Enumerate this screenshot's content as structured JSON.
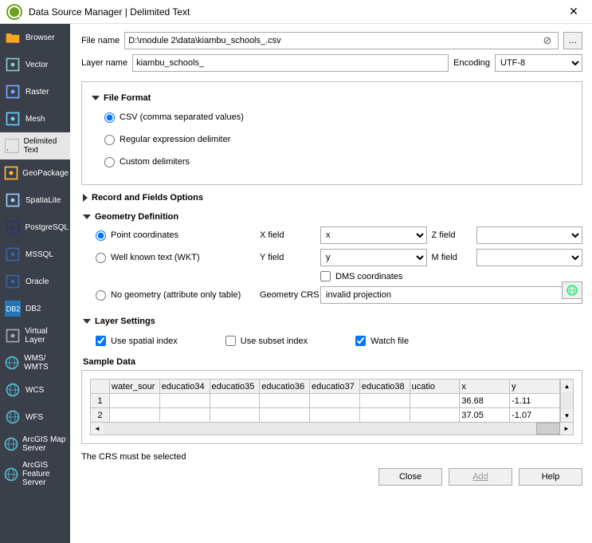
{
  "title": "Data Source Manager | Delimited Text",
  "sidebar": [
    {
      "label": "Browser",
      "icon": "folder"
    },
    {
      "label": "Vector",
      "icon": "vector"
    },
    {
      "label": "Raster",
      "icon": "raster"
    },
    {
      "label": "Mesh",
      "icon": "mesh"
    },
    {
      "label": "Delimited Text",
      "icon": "delim",
      "selected": true
    },
    {
      "label": "GeoPackage",
      "icon": "geopkg"
    },
    {
      "label": "SpatiaLite",
      "icon": "spatia"
    },
    {
      "label": "PostgreSQL",
      "icon": "pg"
    },
    {
      "label": "MSSQL",
      "icon": "mssql"
    },
    {
      "label": "Oracle",
      "icon": "oracle"
    },
    {
      "label": "DB2",
      "icon": "db2"
    },
    {
      "label": "Virtual Layer",
      "icon": "virtual"
    },
    {
      "label": "WMS/ WMTS",
      "icon": "globe"
    },
    {
      "label": "WCS",
      "icon": "globe"
    },
    {
      "label": "WFS",
      "icon": "globe"
    },
    {
      "label": "ArcGIS Map Server",
      "icon": "globe"
    },
    {
      "label": "ArcGIS Feature Server",
      "icon": "globe"
    }
  ],
  "file": {
    "label": "File name",
    "value": "D:\\module 2\\data\\kiambu_schools_.csv",
    "browse": "…"
  },
  "layer": {
    "label": "Layer name",
    "value": "kiambu_schools_",
    "encoding_label": "Encoding",
    "encoding": "UTF-8"
  },
  "fileformat": {
    "title": "File Format",
    "options": [
      "CSV (comma separated values)",
      "Regular expression delimiter",
      "Custom delimiters"
    ],
    "selected": 0
  },
  "recfields": {
    "title": "Record and Fields Options"
  },
  "geom": {
    "title": "Geometry Definition",
    "options": [
      "Point coordinates",
      "Well known text (WKT)",
      "No geometry (attribute only table)"
    ],
    "selected": 0,
    "xlabel": "X field",
    "xval": "x",
    "ylabel": "Y field",
    "yval": "y",
    "zlabel": "Z field",
    "zval": "",
    "mlabel": "M field",
    "mval": "",
    "dms": "DMS coordinates",
    "crs_label": "Geometry CRS",
    "crs_value": "invalid projection"
  },
  "layerset": {
    "title": "Layer Settings",
    "spatial": "Use spatial index",
    "subset": "Use subset index",
    "watch": "Watch file"
  },
  "sample": {
    "title": "Sample Data",
    "columns": [
      "water_sour",
      "educatio34",
      "educatio35",
      "educatio36",
      "educatio37",
      "educatio38",
      "ucatio",
      "x",
      "y"
    ],
    "rows": [
      {
        "n": "1",
        "cells": [
          "",
          "",
          "",
          "",
          "",
          "",
          "",
          "36.68",
          "-1.11"
        ]
      },
      {
        "n": "2",
        "cells": [
          "",
          "",
          "",
          "",
          "",
          "",
          "",
          "37.05",
          "-1.07"
        ]
      }
    ]
  },
  "footer": {
    "msg": "The CRS must be selected",
    "close": "Close",
    "add": "Add",
    "help": "Help"
  }
}
